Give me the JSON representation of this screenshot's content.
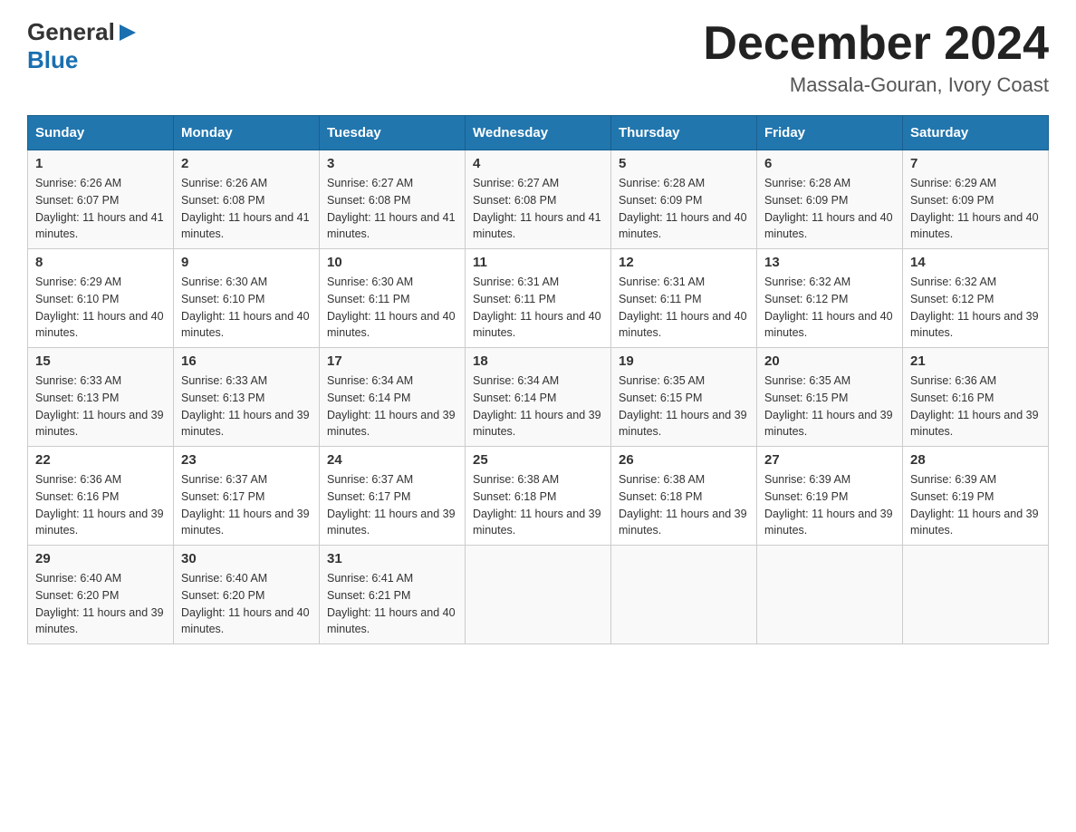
{
  "header": {
    "logo_line1": "General",
    "logo_line2": "Blue",
    "month_title": "December 2024",
    "location": "Massala-Gouran, Ivory Coast"
  },
  "days_of_week": [
    "Sunday",
    "Monday",
    "Tuesday",
    "Wednesday",
    "Thursday",
    "Friday",
    "Saturday"
  ],
  "weeks": [
    [
      {
        "day": "1",
        "sunrise": "6:26 AM",
        "sunset": "6:07 PM",
        "daylight": "11 hours and 41 minutes."
      },
      {
        "day": "2",
        "sunrise": "6:26 AM",
        "sunset": "6:08 PM",
        "daylight": "11 hours and 41 minutes."
      },
      {
        "day": "3",
        "sunrise": "6:27 AM",
        "sunset": "6:08 PM",
        "daylight": "11 hours and 41 minutes."
      },
      {
        "day": "4",
        "sunrise": "6:27 AM",
        "sunset": "6:08 PM",
        "daylight": "11 hours and 41 minutes."
      },
      {
        "day": "5",
        "sunrise": "6:28 AM",
        "sunset": "6:09 PM",
        "daylight": "11 hours and 40 minutes."
      },
      {
        "day": "6",
        "sunrise": "6:28 AM",
        "sunset": "6:09 PM",
        "daylight": "11 hours and 40 minutes."
      },
      {
        "day": "7",
        "sunrise": "6:29 AM",
        "sunset": "6:09 PM",
        "daylight": "11 hours and 40 minutes."
      }
    ],
    [
      {
        "day": "8",
        "sunrise": "6:29 AM",
        "sunset": "6:10 PM",
        "daylight": "11 hours and 40 minutes."
      },
      {
        "day": "9",
        "sunrise": "6:30 AM",
        "sunset": "6:10 PM",
        "daylight": "11 hours and 40 minutes."
      },
      {
        "day": "10",
        "sunrise": "6:30 AM",
        "sunset": "6:11 PM",
        "daylight": "11 hours and 40 minutes."
      },
      {
        "day": "11",
        "sunrise": "6:31 AM",
        "sunset": "6:11 PM",
        "daylight": "11 hours and 40 minutes."
      },
      {
        "day": "12",
        "sunrise": "6:31 AM",
        "sunset": "6:11 PM",
        "daylight": "11 hours and 40 minutes."
      },
      {
        "day": "13",
        "sunrise": "6:32 AM",
        "sunset": "6:12 PM",
        "daylight": "11 hours and 40 minutes."
      },
      {
        "day": "14",
        "sunrise": "6:32 AM",
        "sunset": "6:12 PM",
        "daylight": "11 hours and 39 minutes."
      }
    ],
    [
      {
        "day": "15",
        "sunrise": "6:33 AM",
        "sunset": "6:13 PM",
        "daylight": "11 hours and 39 minutes."
      },
      {
        "day": "16",
        "sunrise": "6:33 AM",
        "sunset": "6:13 PM",
        "daylight": "11 hours and 39 minutes."
      },
      {
        "day": "17",
        "sunrise": "6:34 AM",
        "sunset": "6:14 PM",
        "daylight": "11 hours and 39 minutes."
      },
      {
        "day": "18",
        "sunrise": "6:34 AM",
        "sunset": "6:14 PM",
        "daylight": "11 hours and 39 minutes."
      },
      {
        "day": "19",
        "sunrise": "6:35 AM",
        "sunset": "6:15 PM",
        "daylight": "11 hours and 39 minutes."
      },
      {
        "day": "20",
        "sunrise": "6:35 AM",
        "sunset": "6:15 PM",
        "daylight": "11 hours and 39 minutes."
      },
      {
        "day": "21",
        "sunrise": "6:36 AM",
        "sunset": "6:16 PM",
        "daylight": "11 hours and 39 minutes."
      }
    ],
    [
      {
        "day": "22",
        "sunrise": "6:36 AM",
        "sunset": "6:16 PM",
        "daylight": "11 hours and 39 minutes."
      },
      {
        "day": "23",
        "sunrise": "6:37 AM",
        "sunset": "6:17 PM",
        "daylight": "11 hours and 39 minutes."
      },
      {
        "day": "24",
        "sunrise": "6:37 AM",
        "sunset": "6:17 PM",
        "daylight": "11 hours and 39 minutes."
      },
      {
        "day": "25",
        "sunrise": "6:38 AM",
        "sunset": "6:18 PM",
        "daylight": "11 hours and 39 minutes."
      },
      {
        "day": "26",
        "sunrise": "6:38 AM",
        "sunset": "6:18 PM",
        "daylight": "11 hours and 39 minutes."
      },
      {
        "day": "27",
        "sunrise": "6:39 AM",
        "sunset": "6:19 PM",
        "daylight": "11 hours and 39 minutes."
      },
      {
        "day": "28",
        "sunrise": "6:39 AM",
        "sunset": "6:19 PM",
        "daylight": "11 hours and 39 minutes."
      }
    ],
    [
      {
        "day": "29",
        "sunrise": "6:40 AM",
        "sunset": "6:20 PM",
        "daylight": "11 hours and 39 minutes."
      },
      {
        "day": "30",
        "sunrise": "6:40 AM",
        "sunset": "6:20 PM",
        "daylight": "11 hours and 40 minutes."
      },
      {
        "day": "31",
        "sunrise": "6:41 AM",
        "sunset": "6:21 PM",
        "daylight": "11 hours and 40 minutes."
      },
      null,
      null,
      null,
      null
    ]
  ]
}
